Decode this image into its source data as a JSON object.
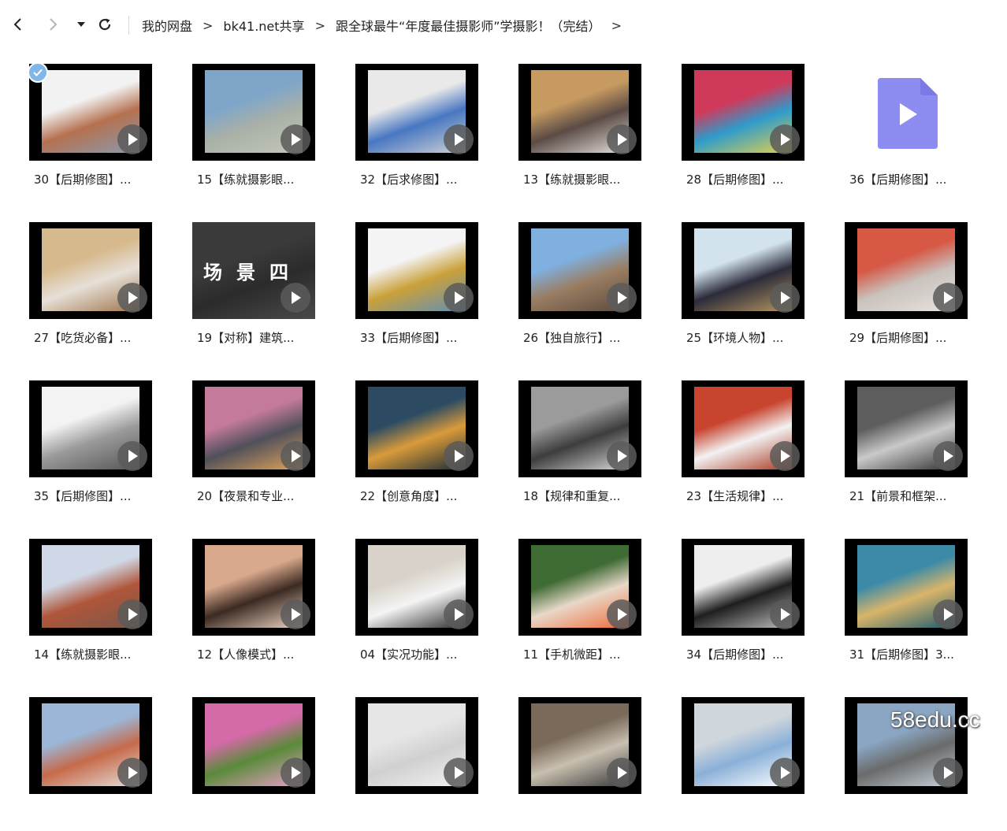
{
  "toolbar": {
    "icons": [
      "back-icon",
      "forward-icon",
      "dropdown-icon",
      "refresh-icon"
    ]
  },
  "breadcrumb": {
    "items": [
      "我的网盘",
      "bk41.net共享",
      "跟全球最牛“年度最佳摄影师”学摄影！（完结）"
    ],
    "separator": ">"
  },
  "files": [
    {
      "label": "30【后期修图】...",
      "colors": [
        "#f2f2f2",
        "#b5714f",
        "#8a9ab0"
      ],
      "selected": true
    },
    {
      "label": "15【练就摄影眼...",
      "colors": [
        "#7fa6c9",
        "#a9b0a7",
        "#c2c7b8"
      ]
    },
    {
      "label": "32【后求修图】...",
      "colors": [
        "#e9e9e9",
        "#4877c2",
        "#d0d3d6"
      ]
    },
    {
      "label": "13【练就摄影眼...",
      "colors": [
        "#c69a61",
        "#5b4b45",
        "#e6e2de"
      ]
    },
    {
      "label": "28【后期修图】...",
      "colors": [
        "#cf3a5a",
        "#2f9bcb",
        "#e4d24a"
      ]
    },
    {
      "label": "36【后期修图】...",
      "colors": [
        "#8d8cf0",
        "#7a79e6"
      ],
      "file_icon": true
    },
    {
      "label": "27【吃货必备】...",
      "colors": [
        "#d7b98e",
        "#e6e0d8",
        "#a0744a"
      ]
    },
    {
      "label": "19【对称】建筑...",
      "colors": [
        "#3a3a3a",
        "#2b2b2b",
        "#4a4a4a"
      ],
      "scene_text": "场景四"
    },
    {
      "label": "33【后期修图】...",
      "colors": [
        "#f4f4f4",
        "#caa13a",
        "#5f8fb8"
      ]
    },
    {
      "label": "26【独自旅行】...",
      "colors": [
        "#7fb0e0",
        "#9a7d62",
        "#5a4a3e"
      ]
    },
    {
      "label": "25【环境人物】...",
      "colors": [
        "#d3e3ee",
        "#2b2b3a",
        "#b89760"
      ]
    },
    {
      "label": "29【后期修图】...",
      "colors": [
        "#d65845",
        "#c9c2bd",
        "#e8e4e0"
      ]
    },
    {
      "label": "35【后期修图】...",
      "colors": [
        "#f3f3f3",
        "#9a9a9a",
        "#555555"
      ]
    },
    {
      "label": "20【夜景和专业...",
      "colors": [
        "#c47a9b",
        "#50505a",
        "#e0a35a"
      ]
    },
    {
      "label": "22【创意角度】...",
      "colors": [
        "#2c4b63",
        "#d99b3a",
        "#1a2a36"
      ]
    },
    {
      "label": "18【规律和重复...",
      "colors": [
        "#9b9b9b",
        "#3d3d3d",
        "#d6d6d6"
      ]
    },
    {
      "label": "23【生活规律】...",
      "colors": [
        "#c8442e",
        "#f2f2f2",
        "#a9371f"
      ]
    },
    {
      "label": "21【前景和框架...",
      "colors": [
        "#5d5d5d",
        "#c9c9c9",
        "#333333"
      ]
    },
    {
      "label": "14【练就摄影眼...",
      "colors": [
        "#cfd8e6",
        "#b0563a",
        "#7a5848"
      ]
    },
    {
      "label": "12【人像模式】...",
      "colors": [
        "#d9a98d",
        "#3b2a22",
        "#f0d7c6"
      ]
    },
    {
      "label": "04【实况功能】...",
      "colors": [
        "#d8d2c8",
        "#f4f4f4",
        "#2a2a2a"
      ]
    },
    {
      "label": "11【手机微距】...",
      "colors": [
        "#3f6b35",
        "#e8d8c8",
        "#f06a3a"
      ]
    },
    {
      "label": "34【后期修图】...",
      "colors": [
        "#eeeeee",
        "#1e1e1e",
        "#bfbfbf"
      ]
    },
    {
      "label": "31【后期修图】3...",
      "colors": [
        "#3c8aa8",
        "#d9b56a",
        "#1d5a70"
      ]
    },
    {
      "label": "",
      "colors": [
        "#9bb6d6",
        "#c66a4a",
        "#e5e0da"
      ]
    },
    {
      "label": "",
      "colors": [
        "#d46aa8",
        "#5a8a3a",
        "#e8a0c8"
      ]
    },
    {
      "label": "",
      "colors": [
        "#e6e6e6",
        "#d0d0d0",
        "#f2f2f2"
      ]
    },
    {
      "label": "",
      "colors": [
        "#7a6a5a",
        "#c8c0b0",
        "#3a3a3a"
      ]
    },
    {
      "label": "",
      "colors": [
        "#cfd6dc",
        "#8ab0d8",
        "#ffffff"
      ]
    },
    {
      "label": "",
      "colors": [
        "#8aa6c2",
        "#6a6a6a",
        "#c6d3de"
      ]
    }
  ],
  "watermark": "58edu.cc"
}
